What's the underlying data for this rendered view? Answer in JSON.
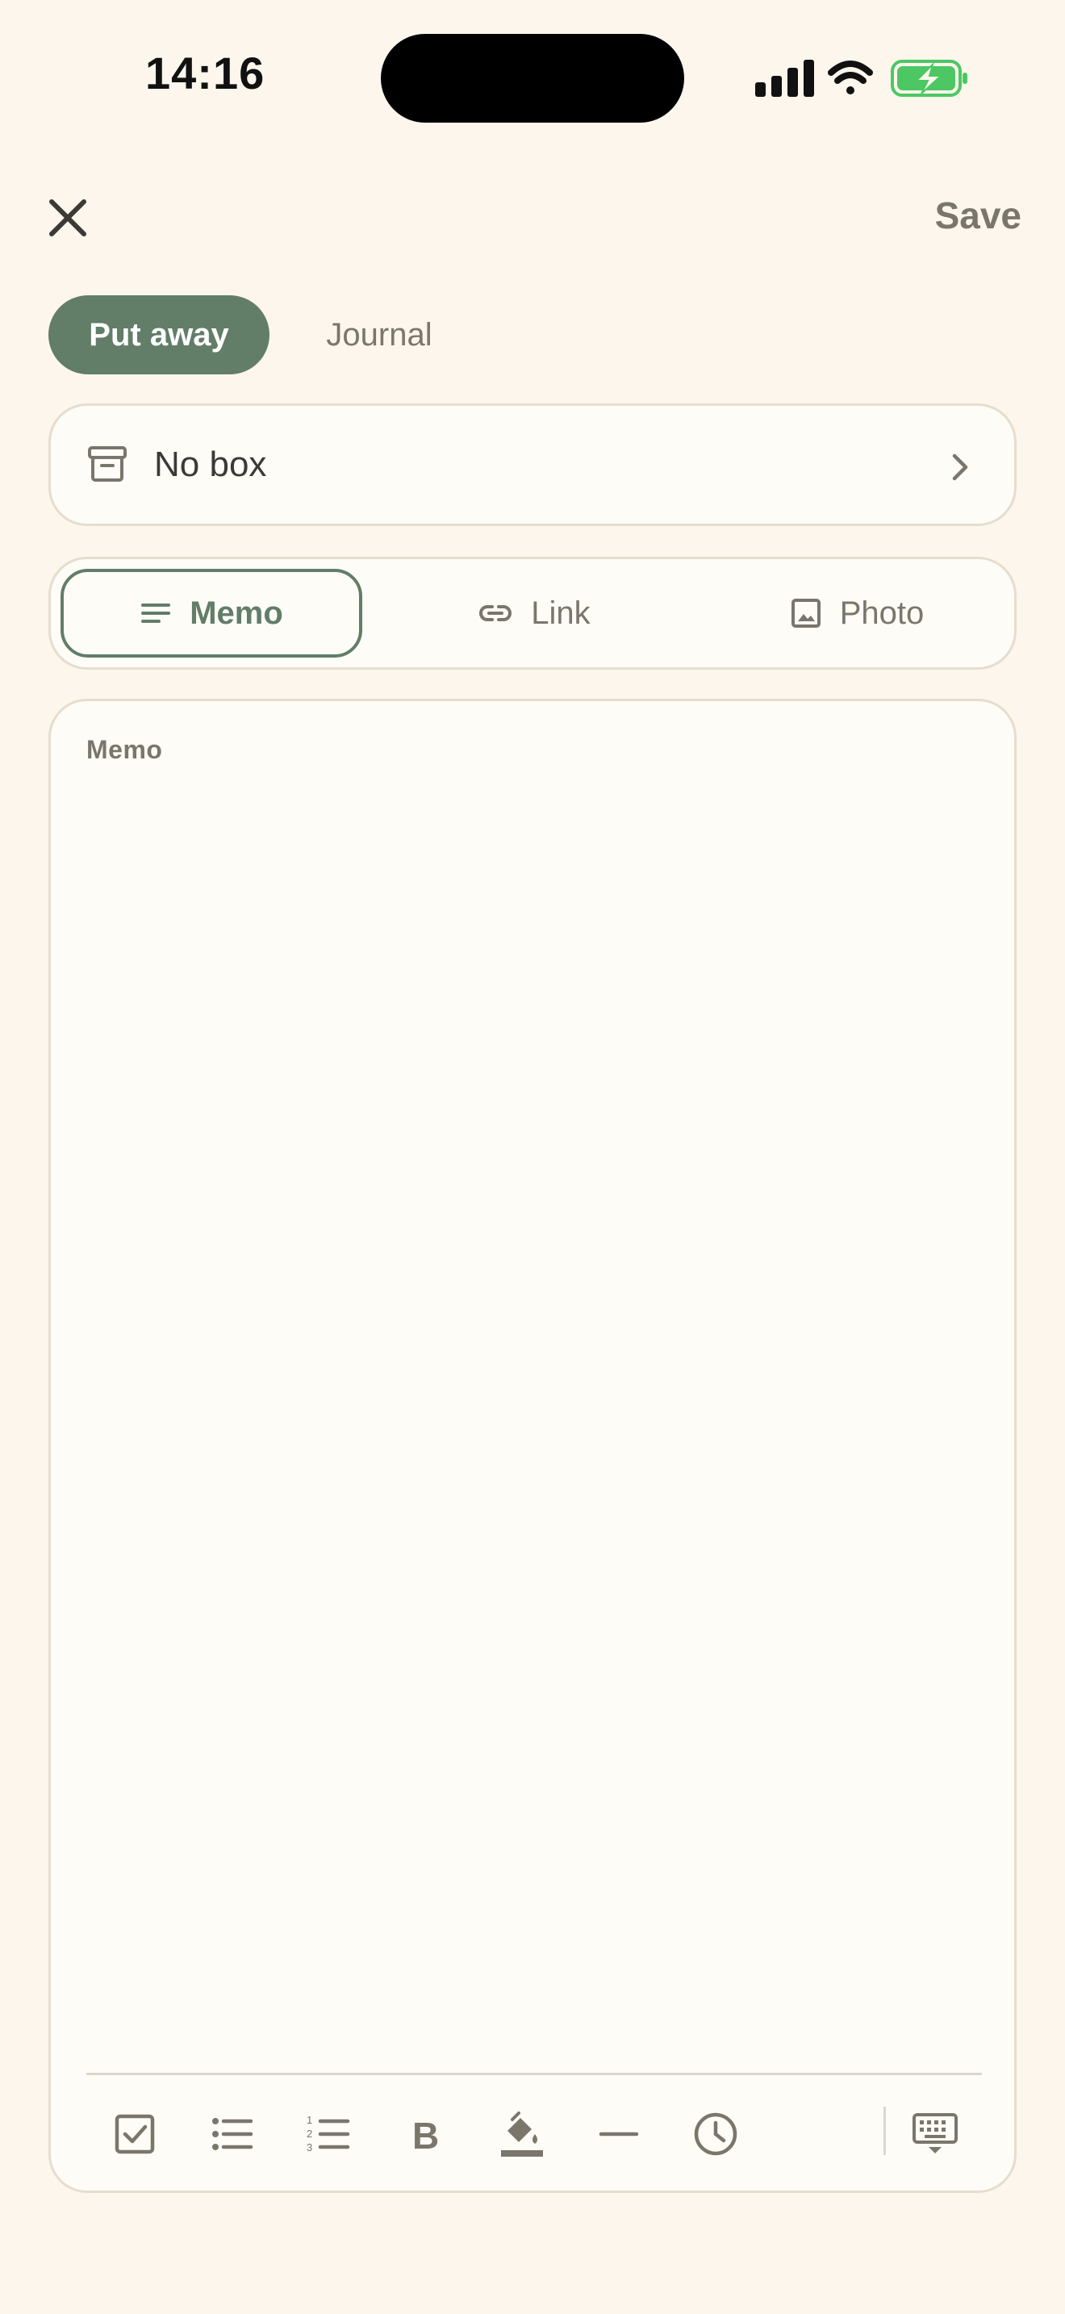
{
  "status_bar": {
    "time": "14:16"
  },
  "header": {
    "close_icon": "close-icon",
    "save_label": "Save"
  },
  "mode": {
    "options": [
      "Put away",
      "Journal"
    ],
    "selected": "Put away"
  },
  "box_selector": {
    "label": "No box",
    "icon": "archive-box-icon"
  },
  "type_tabs": {
    "items": [
      {
        "label": "Memo",
        "icon": "lines-icon"
      },
      {
        "label": "Link",
        "icon": "link-icon"
      },
      {
        "label": "Photo",
        "icon": "image-icon"
      }
    ],
    "selected": "Memo"
  },
  "memo": {
    "label": "Memo",
    "value": ""
  },
  "toolbar": {
    "tools": [
      "checkbox-icon",
      "bullet-list-icon",
      "numbered-list-icon",
      "bold-icon",
      "highlight-icon",
      "divider-line-icon",
      "clock-icon",
      "keyboard-dismiss-icon"
    ]
  },
  "colors": {
    "background": "#fcf6ec",
    "card": "#fefcf7",
    "border": "#e6ddcd",
    "accent": "#627d68",
    "muted_text": "#7b766c",
    "battery": "#4cc764"
  }
}
